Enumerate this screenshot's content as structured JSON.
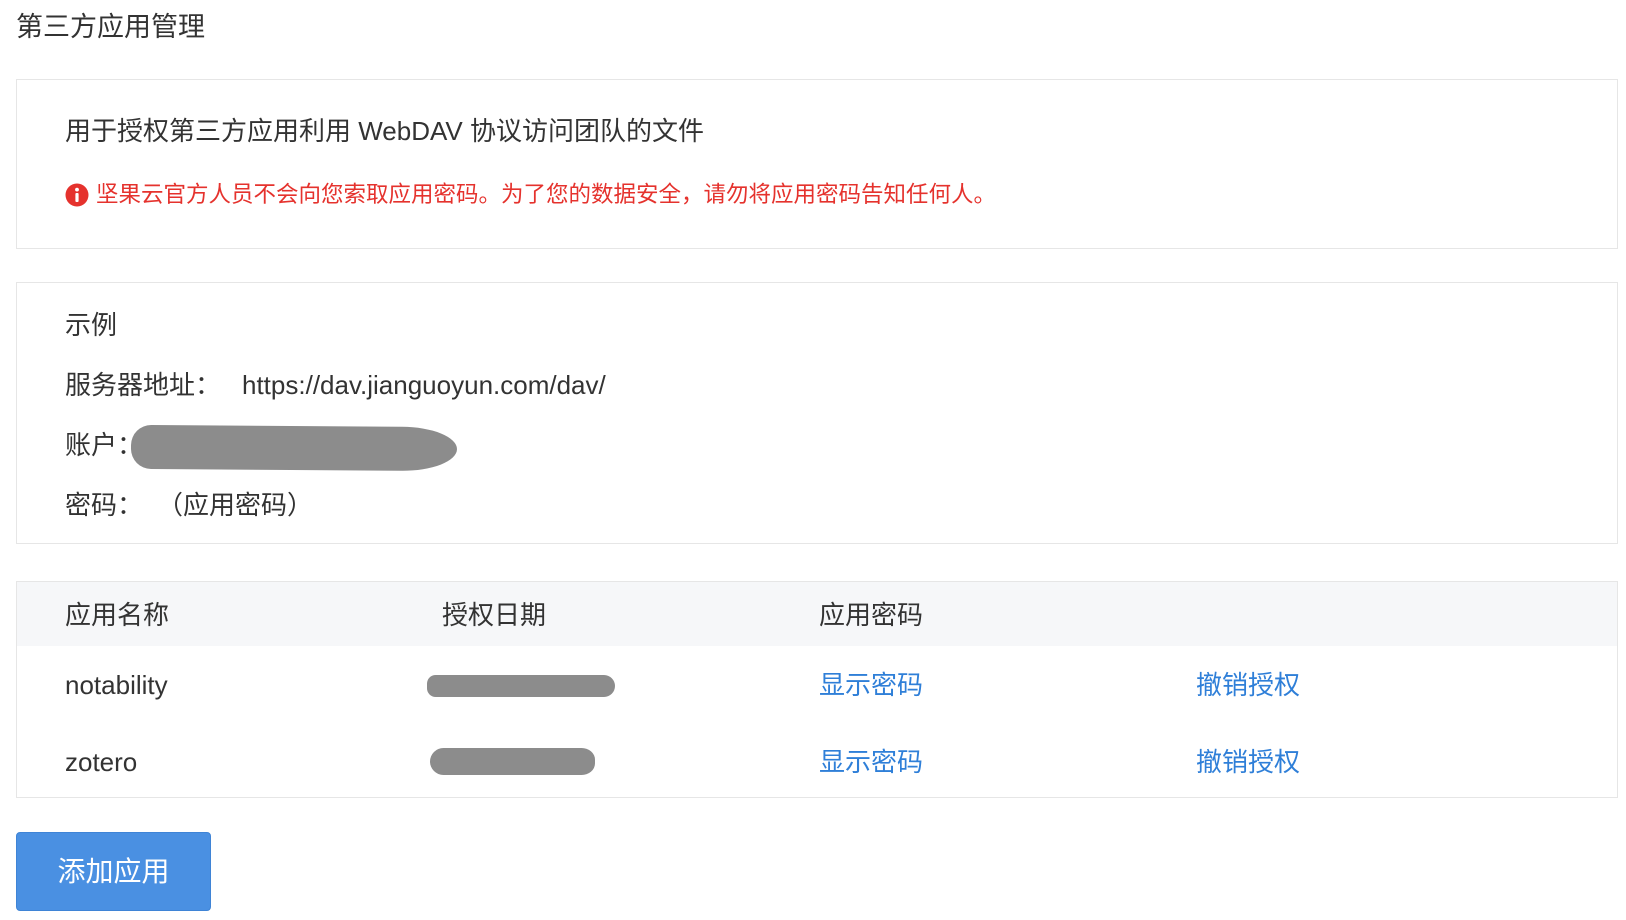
{
  "page": {
    "title": "第三方应用管理"
  },
  "intro": {
    "description": "用于授权第三方应用利用 WebDAV 协议访问团队的文件",
    "warning_icon": "info-icon",
    "warning_text": "坚果云官方人员不会向您索取应用密码。为了您的数据安全，请勿将应用密码告知任何人。"
  },
  "example": {
    "title": "示例",
    "server_label": "服务器地址：",
    "server_value": "https://dav.jianguoyun.com/dav/",
    "account_label": "账户：",
    "password_label": "密码：",
    "password_value": "（应用密码）"
  },
  "table": {
    "headers": [
      "应用名称",
      "授权日期",
      "应用密码"
    ],
    "rows": [
      {
        "name": "notability",
        "show_password": "显示密码",
        "revoke": "撤销授权"
      },
      {
        "name": "zotero",
        "show_password": "显示密码",
        "revoke": "撤销授权"
      }
    ]
  },
  "actions": {
    "add_app_label": "添加应用"
  },
  "colors": {
    "accent": "#4a90e2",
    "danger": "#e5322d",
    "link": "#2f7fd8",
    "text": "#333333",
    "header_bg": "#f6f7f9",
    "redaction": "#8c8c8c"
  }
}
